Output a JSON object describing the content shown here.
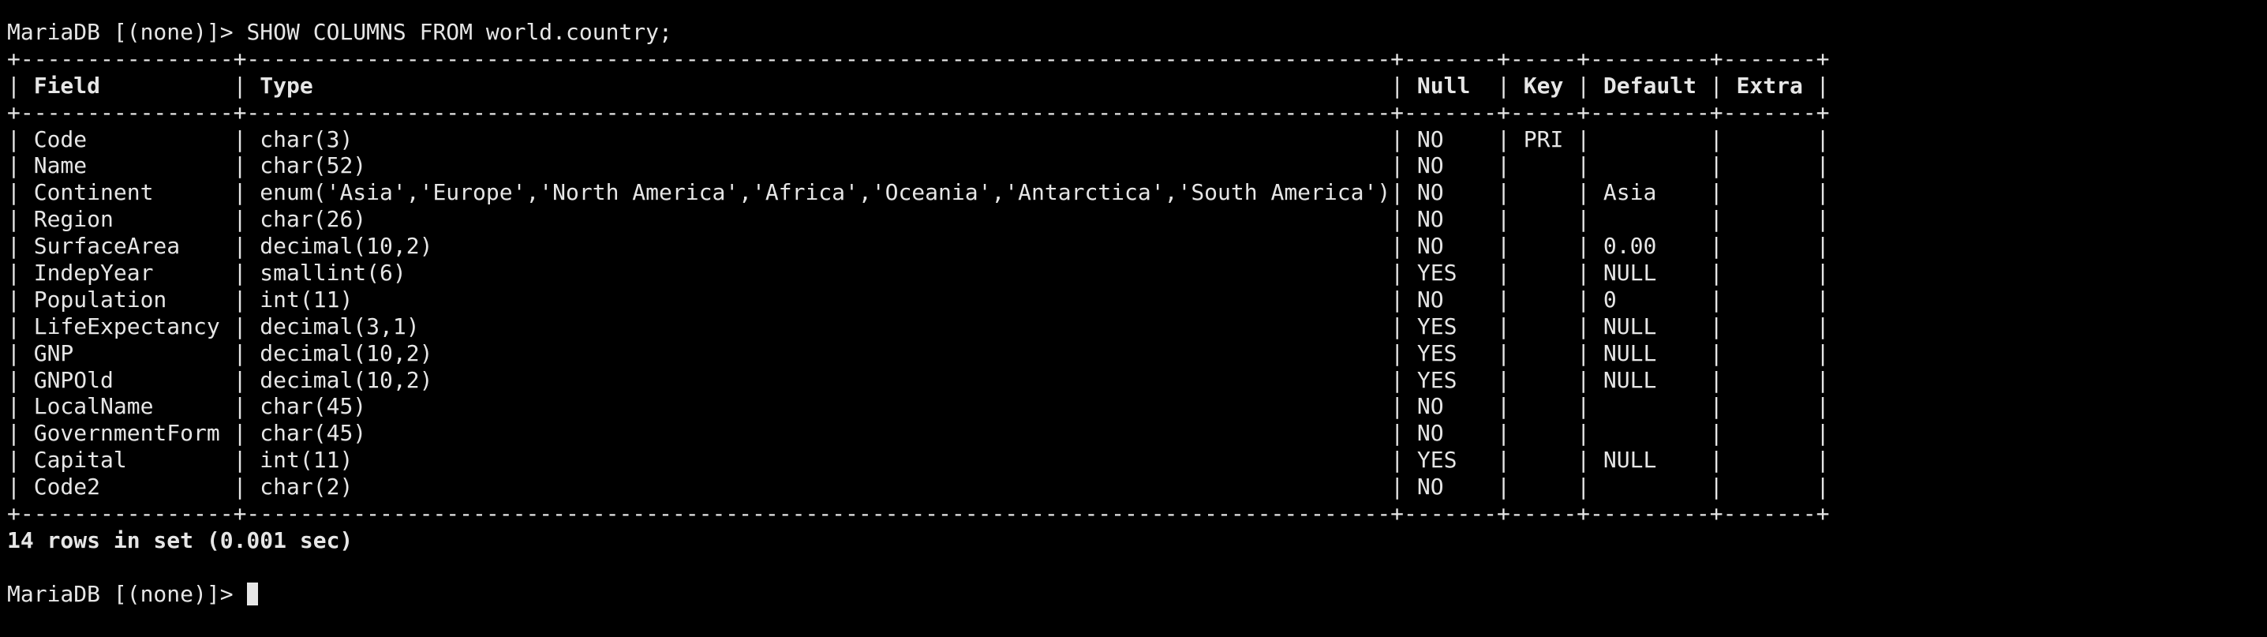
{
  "terminal": {
    "prompt": "MariaDB [(none)]>",
    "command": "SHOW COLUMNS FROM world.country;",
    "summary": "14 rows in set (0.001 sec)",
    "colors": {
      "background": "#000000",
      "foreground": "#e6e6e6"
    }
  },
  "table": {
    "widths": [
      16,
      86,
      7,
      5,
      9,
      7
    ],
    "headers": [
      "Field",
      "Type",
      "Null",
      "Key",
      "Default",
      "Extra"
    ],
    "rows": [
      [
        "Code",
        "char(3)",
        "NO",
        "PRI",
        "",
        ""
      ],
      [
        "Name",
        "char(52)",
        "NO",
        "",
        "",
        ""
      ],
      [
        "Continent",
        "enum('Asia','Europe','North America','Africa','Oceania','Antarctica','South America')",
        "NO",
        "",
        "Asia",
        ""
      ],
      [
        "Region",
        "char(26)",
        "NO",
        "",
        "",
        ""
      ],
      [
        "SurfaceArea",
        "decimal(10,2)",
        "NO",
        "",
        "0.00",
        ""
      ],
      [
        "IndepYear",
        "smallint(6)",
        "YES",
        "",
        "NULL",
        ""
      ],
      [
        "Population",
        "int(11)",
        "NO",
        "",
        "0",
        ""
      ],
      [
        "LifeExpectancy",
        "decimal(3,1)",
        "YES",
        "",
        "NULL",
        ""
      ],
      [
        "GNP",
        "decimal(10,2)",
        "YES",
        "",
        "NULL",
        ""
      ],
      [
        "GNPOld",
        "decimal(10,2)",
        "YES",
        "",
        "NULL",
        ""
      ],
      [
        "LocalName",
        "char(45)",
        "NO",
        "",
        "",
        ""
      ],
      [
        "GovernmentForm",
        "char(45)",
        "NO",
        "",
        "",
        ""
      ],
      [
        "Capital",
        "int(11)",
        "YES",
        "",
        "NULL",
        ""
      ],
      [
        "Code2",
        "char(2)",
        "NO",
        "",
        "",
        ""
      ]
    ]
  }
}
